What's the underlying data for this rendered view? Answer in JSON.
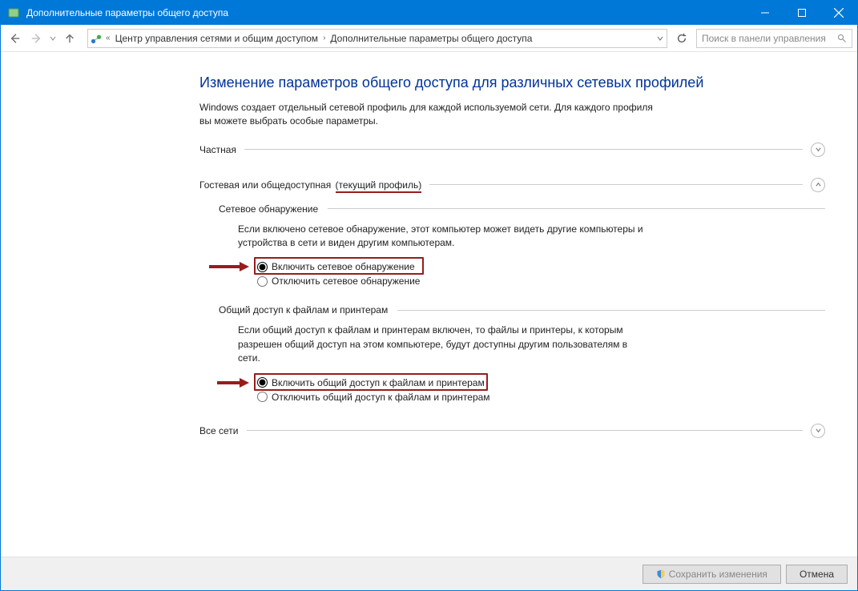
{
  "titlebar": {
    "title": "Дополнительные параметры общего доступа"
  },
  "breadcrumb": {
    "item1": "Центр управления сетями и общим доступом",
    "item2": "Дополнительные параметры общего доступа"
  },
  "search": {
    "placeholder": "Поиск в панели управления"
  },
  "page": {
    "title": "Изменение параметров общего доступа для различных сетевых профилей",
    "desc": "Windows создает отдельный сетевой профиль для каждой используемой сети. Для каждого профиля вы можете выбрать особые параметры."
  },
  "profiles": {
    "private": {
      "label": "Частная"
    },
    "guest": {
      "label": "Гостевая или общедоступная",
      "current": "(текущий профиль)"
    },
    "all": {
      "label": "Все сети"
    }
  },
  "discovery": {
    "header": "Сетевое обнаружение",
    "desc": "Если включено сетевое обнаружение, этот компьютер может видеть другие компьютеры и устройства в сети и виден другим компьютерам.",
    "on": "Включить сетевое обнаружение",
    "off": "Отключить сетевое обнаружение"
  },
  "sharing": {
    "header": "Общий доступ к файлам и принтерам",
    "desc": "Если общий доступ к файлам и принтерам включен, то файлы и принтеры, к которым разрешен общий доступ на этом компьютере, будут доступны другим пользователям в сети.",
    "on": "Включить общий доступ к файлам и принтерам",
    "off": "Отключить общий доступ к файлам и принтерам"
  },
  "footer": {
    "save": "Сохранить изменения",
    "cancel": "Отмена"
  }
}
